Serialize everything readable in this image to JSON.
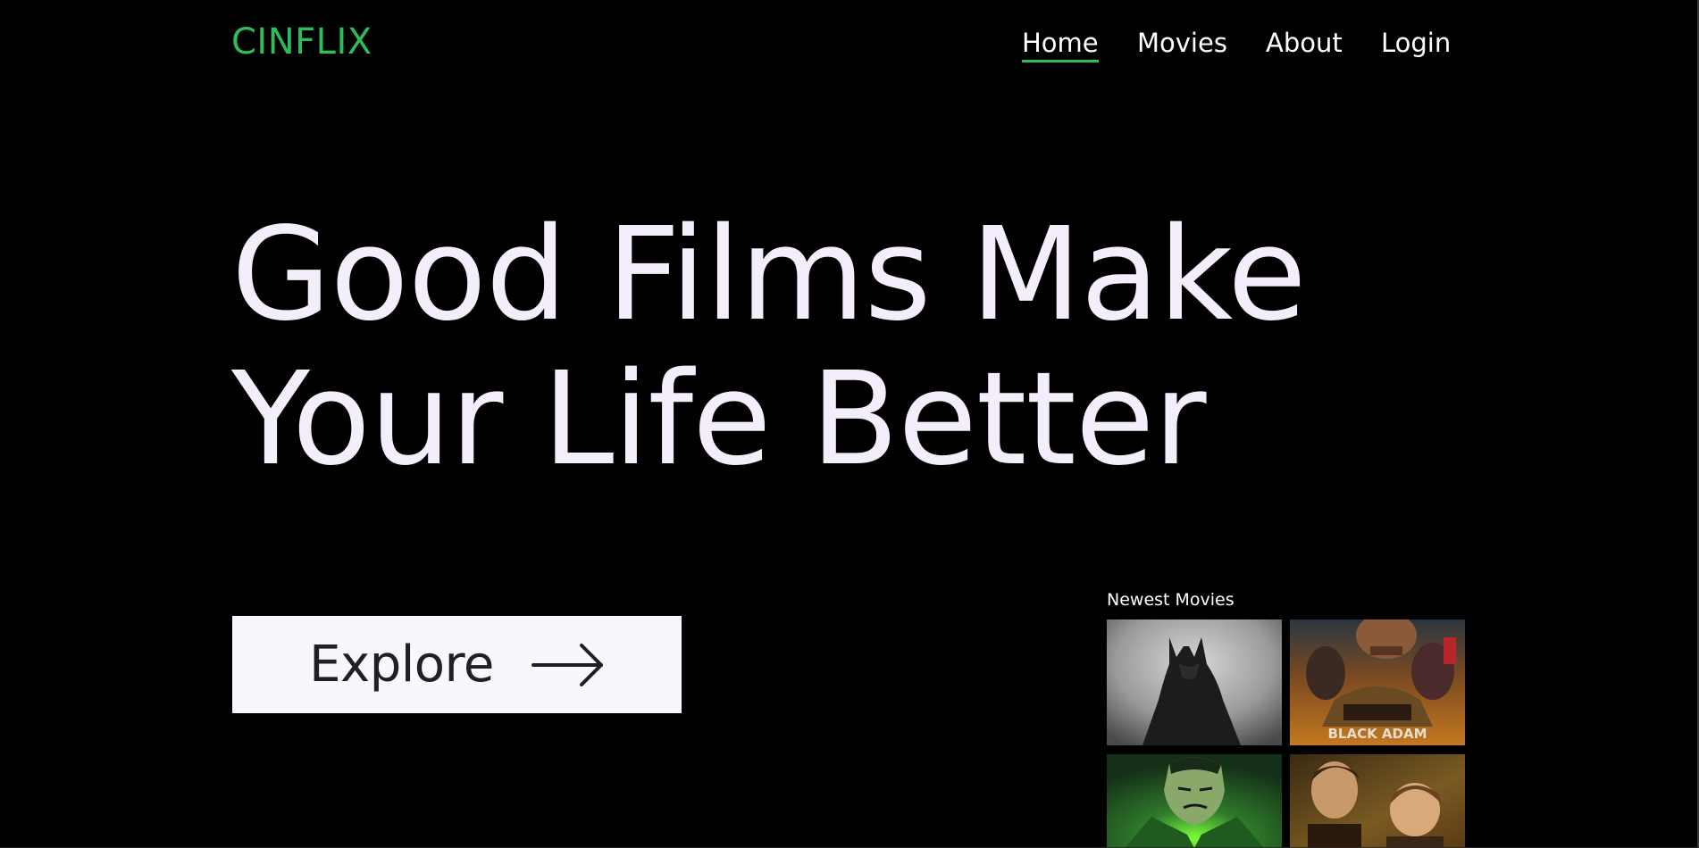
{
  "brand": {
    "name": "CINFLIX",
    "color": "#2ebd59"
  },
  "nav": {
    "items": [
      {
        "label": "Home",
        "active": true
      },
      {
        "label": "Movies",
        "active": false
      },
      {
        "label": "About",
        "active": false
      },
      {
        "label": "Login",
        "active": false
      }
    ]
  },
  "hero": {
    "line1": "Good Films Make",
    "line2": "Your Life Better",
    "text_color": "#f4eefc"
  },
  "cta": {
    "label": "Explore",
    "icon": "arrow-right-icon"
  },
  "newest": {
    "title": "Newest Movies",
    "posters": [
      {
        "name": "poster-dark-caped-hero",
        "art_text": ""
      },
      {
        "name": "poster-black-adam",
        "art_text": "BLACK ADAM"
      },
      {
        "name": "poster-green-animated-hero",
        "art_text": ""
      },
      {
        "name": "poster-two-young-men",
        "art_text": ""
      }
    ]
  },
  "colors": {
    "background": "#000000",
    "accent": "#2ebd59",
    "button_bg": "#f7f8fb",
    "button_text": "#1f1f24"
  }
}
